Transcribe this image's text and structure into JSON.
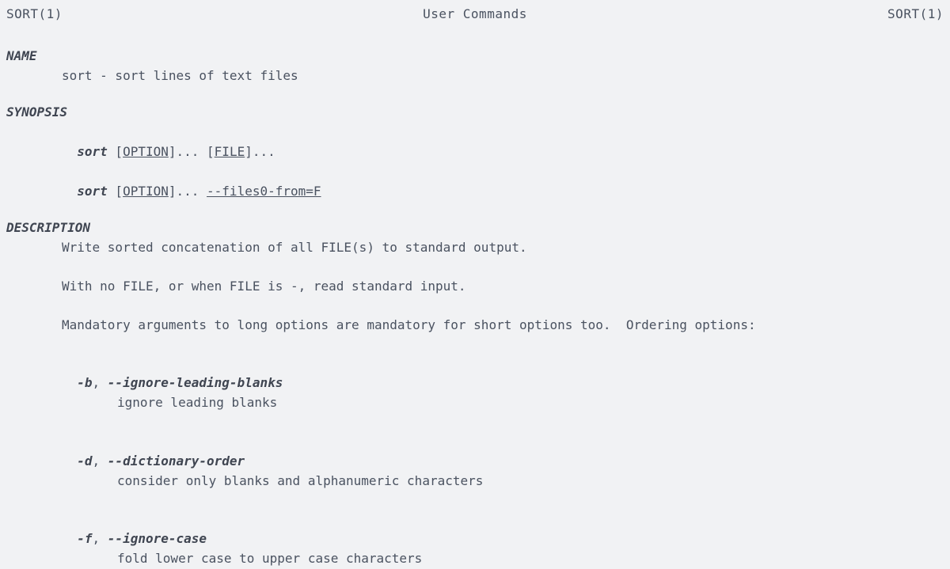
{
  "header": {
    "left": "SORT(1)",
    "center": "User Commands",
    "right": "SORT(1)"
  },
  "sections": {
    "name": {
      "heading": "NAME",
      "text": "sort - sort lines of text files"
    },
    "synopsis": {
      "heading": "SYNOPSIS",
      "cmd": "sort",
      "opt_label": "OPTION",
      "file_label": "FILE",
      "ellipsis_open": " [",
      "ellipsis_close": "]... ",
      "ellipsis_close2": "]...",
      "files0": "--files0-from=F"
    },
    "description": {
      "heading": "DESCRIPTION",
      "p1": "Write sorted concatenation of all FILE(s) to standard output.",
      "p2": "With no FILE, or when FILE is -, read standard input.",
      "p3": "Mandatory arguments to long options are mandatory for short options too.  Ordering options:"
    },
    "options": [
      {
        "short": "-b",
        "long": "--ignore-leading-blanks",
        "desc": "ignore leading blanks"
      },
      {
        "short": "-d",
        "long": "--dictionary-order",
        "desc": "consider only blanks and alphanumeric characters"
      },
      {
        "short": "-f",
        "long": "--ignore-case",
        "desc": "fold lower case to upper case characters"
      }
    ],
    "sep": ", "
  }
}
